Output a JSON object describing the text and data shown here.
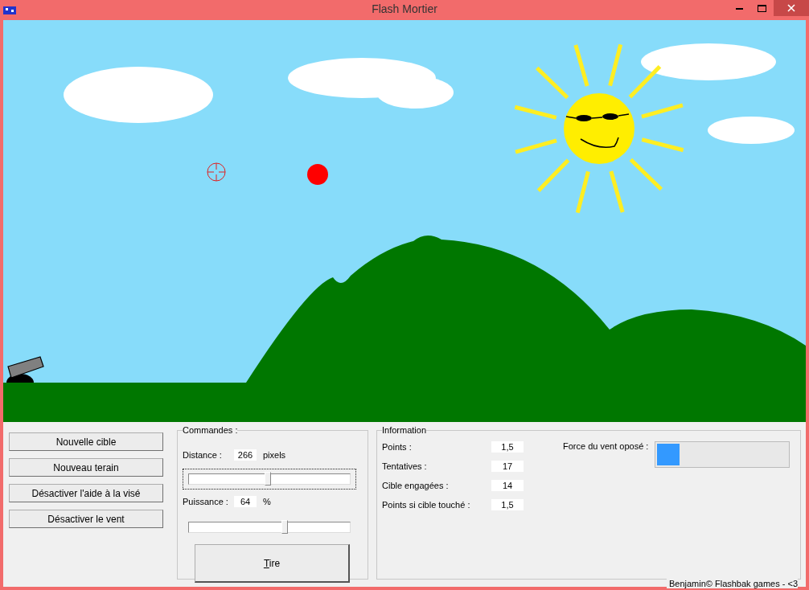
{
  "window": {
    "title": "Flash Mortier"
  },
  "actions": [
    "Nouvelle cible",
    "Nouveau terain",
    "Désactiver l'aide à la visé",
    "Désactiver le vent"
  ],
  "commands": {
    "title": "Commandes :",
    "distance": {
      "label": "Distance :",
      "value": "266",
      "unit": "pixels",
      "level": 0.49,
      "focused": true
    },
    "power": {
      "label": "Puissance :",
      "value": "64",
      "unit": "%",
      "level": 0.6,
      "focused": false
    },
    "fire_button": "Tire"
  },
  "information": {
    "title": "Information",
    "stats": [
      {
        "label": "Points :",
        "value": "1,5"
      },
      {
        "label": "Tentatives :",
        "value": "17"
      },
      {
        "label": "Cible engagées :",
        "value": "14"
      },
      {
        "label": "Points si cible touché :",
        "value": "1,5"
      }
    ],
    "wind": {
      "label": "Force du vent oposé :",
      "level": 0.17
    }
  },
  "footer": "Benjamin© Flashbak games - <3"
}
